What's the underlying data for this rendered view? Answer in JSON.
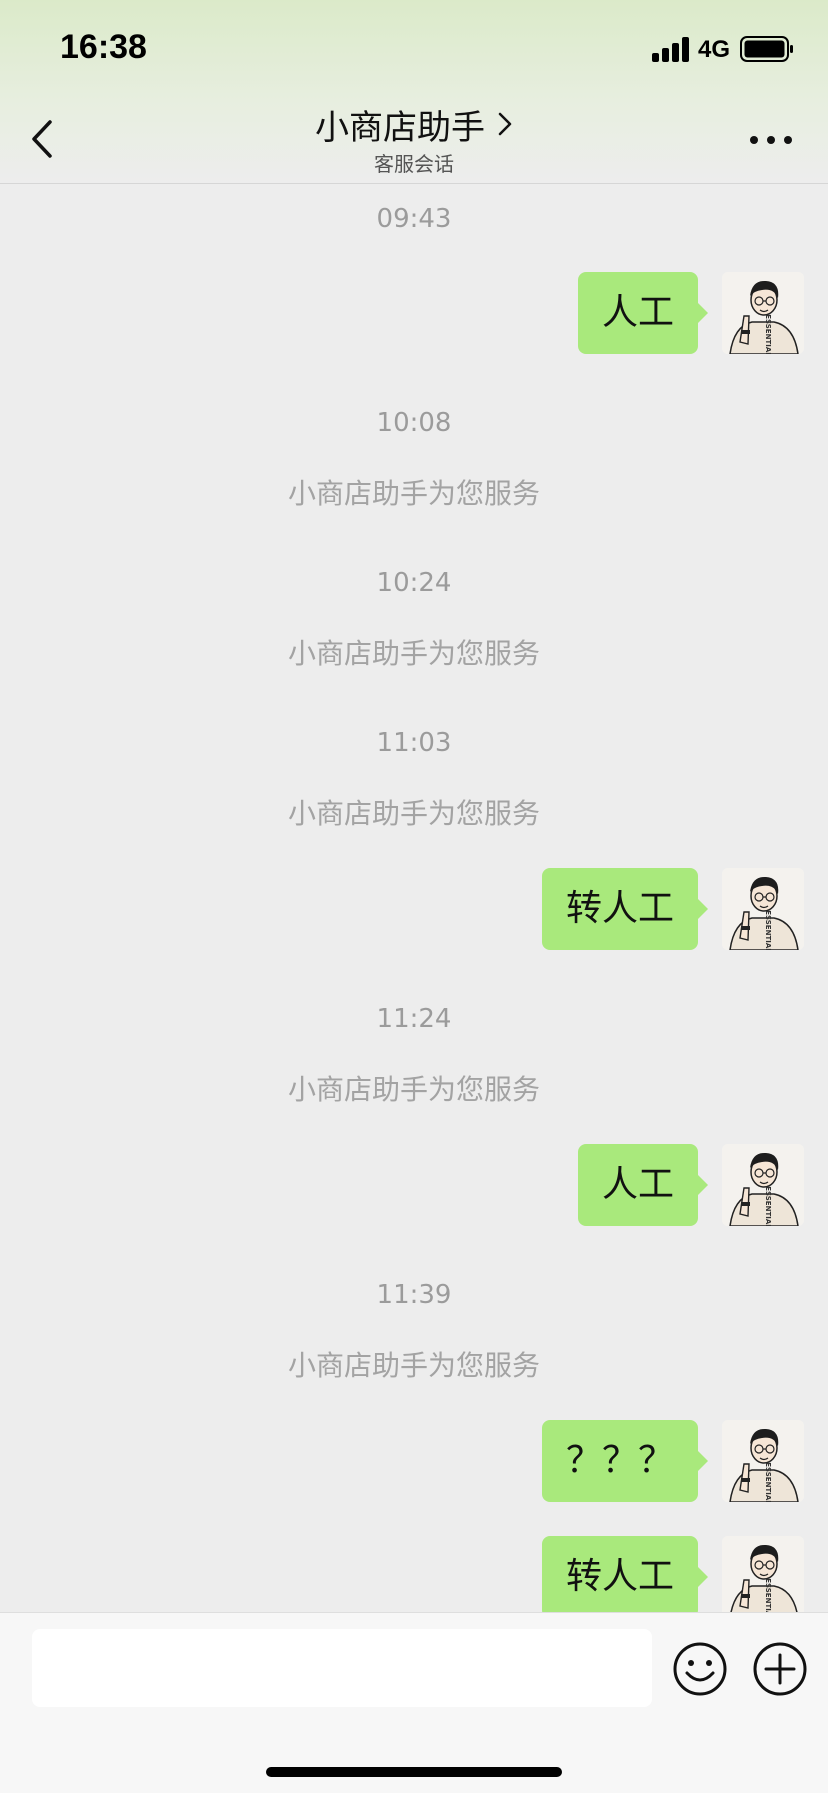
{
  "status_bar": {
    "time": "16:38",
    "network": "4G"
  },
  "header": {
    "title": "小商店助手",
    "subtitle": "客服会话"
  },
  "chat": {
    "avatar_shirt_text": "ESSENTIALS",
    "messages": [
      {
        "type": "timestamp",
        "text": "09:43"
      },
      {
        "type": "outgoing",
        "text": "人工"
      },
      {
        "type": "timestamp",
        "text": "10:08"
      },
      {
        "type": "system",
        "text": "小商店助手为您服务"
      },
      {
        "type": "timestamp",
        "text": "10:24"
      },
      {
        "type": "system",
        "text": "小商店助手为您服务"
      },
      {
        "type": "timestamp",
        "text": "11:03"
      },
      {
        "type": "system",
        "text": "小商店助手为您服务"
      },
      {
        "type": "outgoing",
        "text": "转人工"
      },
      {
        "type": "timestamp",
        "text": "11:24"
      },
      {
        "type": "system",
        "text": "小商店助手为您服务"
      },
      {
        "type": "outgoing",
        "text": "人工"
      },
      {
        "type": "timestamp",
        "text": "11:39"
      },
      {
        "type": "system",
        "text": "小商店助手为您服务"
      },
      {
        "type": "outgoing",
        "text": "？？？"
      },
      {
        "type": "outgoing",
        "text": "转人工"
      }
    ]
  },
  "input_bar": {
    "value": "",
    "placeholder": ""
  },
  "icons": {
    "back": "back-chevron-icon",
    "title_chevron": "chevron-right-icon",
    "more": "more-dots-icon",
    "emoji": "emoji-smile-icon",
    "plus": "plus-circle-icon"
  },
  "colors": {
    "outgoing_bubble": "#a9e97c",
    "chat_background": "#ededed",
    "system_text": "#a3a3a3"
  }
}
